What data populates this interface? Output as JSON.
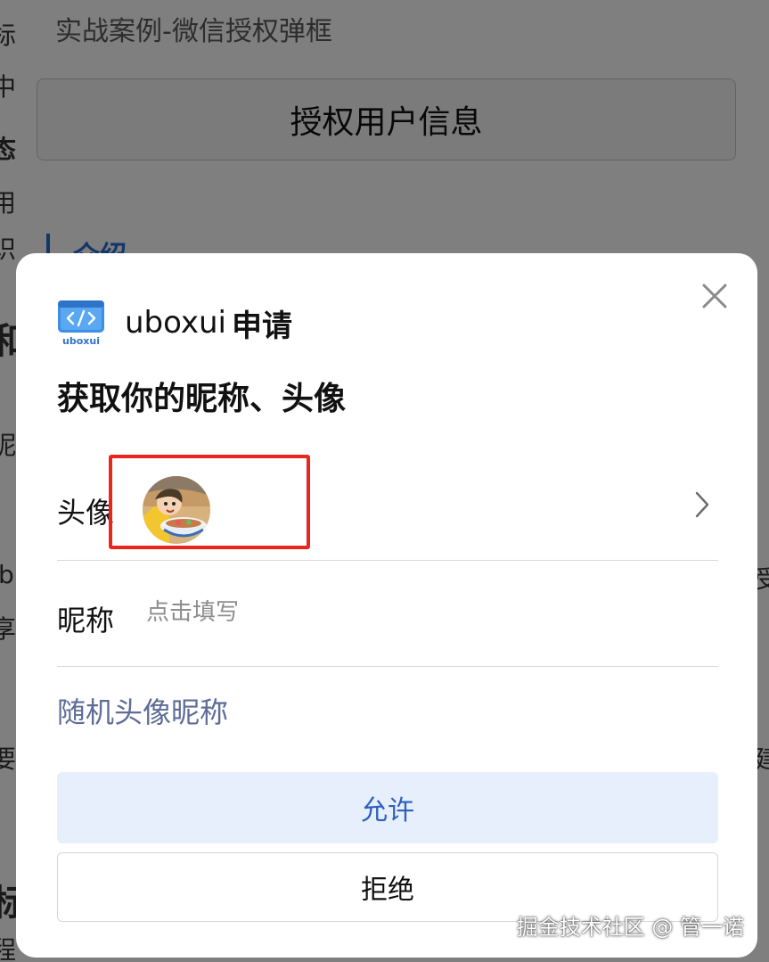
{
  "background": {
    "demo_title": "实战案例-微信授权弹框",
    "auth_button_label": "授权用户信息",
    "section_heading": "介绍",
    "left_edge_chars": [
      "标",
      "中",
      "态",
      "用",
      "识",
      "和",
      "昵",
      "b",
      "享",
      "要",
      "标",
      "程"
    ],
    "right_edge_chars": [
      "受",
      "建"
    ]
  },
  "dialog": {
    "app_name": "uboxui",
    "apply_label": "申请",
    "logo_caption": "uboxui",
    "permission_title": "获取你的昵称、头像",
    "avatar_label": "头像",
    "nickname_label": "昵称",
    "nickname_placeholder": "点击填写",
    "random_link": "随机头像昵称",
    "allow_label": "允许",
    "reject_label": "拒绝"
  },
  "watermark": "掘金技术社区 @ 管一诺",
  "icons": {
    "close": "close-icon",
    "chevron": "chevron-right-icon",
    "logo": "code-brackets-logo"
  },
  "colors": {
    "mask": "#000000",
    "allow_bg": "#e6effb",
    "allow_text": "#2f5fbd",
    "link": "#5f6c96",
    "highlight": "#e8261d"
  }
}
